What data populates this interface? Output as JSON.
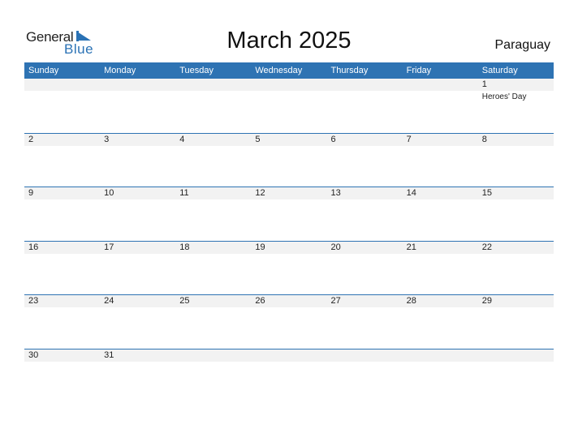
{
  "logo": {
    "general": "General",
    "blue": "Blue"
  },
  "title": "March 2025",
  "country": "Paraguay",
  "weekdays": [
    "Sunday",
    "Monday",
    "Tuesday",
    "Wednesday",
    "Thursday",
    "Friday",
    "Saturday"
  ],
  "weeks": [
    [
      {
        "d": ""
      },
      {
        "d": ""
      },
      {
        "d": ""
      },
      {
        "d": ""
      },
      {
        "d": ""
      },
      {
        "d": ""
      },
      {
        "d": "1",
        "holiday": "Heroes' Day"
      }
    ],
    [
      {
        "d": "2"
      },
      {
        "d": "3"
      },
      {
        "d": "4"
      },
      {
        "d": "5"
      },
      {
        "d": "6"
      },
      {
        "d": "7"
      },
      {
        "d": "8"
      }
    ],
    [
      {
        "d": "9"
      },
      {
        "d": "10"
      },
      {
        "d": "11"
      },
      {
        "d": "12"
      },
      {
        "d": "13"
      },
      {
        "d": "14"
      },
      {
        "d": "15"
      }
    ],
    [
      {
        "d": "16"
      },
      {
        "d": "17"
      },
      {
        "d": "18"
      },
      {
        "d": "19"
      },
      {
        "d": "20"
      },
      {
        "d": "21"
      },
      {
        "d": "22"
      }
    ],
    [
      {
        "d": "23"
      },
      {
        "d": "24"
      },
      {
        "d": "25"
      },
      {
        "d": "26"
      },
      {
        "d": "27"
      },
      {
        "d": "28"
      },
      {
        "d": "29"
      }
    ],
    [
      {
        "d": "30"
      },
      {
        "d": "31"
      },
      {
        "d": ""
      },
      {
        "d": ""
      },
      {
        "d": ""
      },
      {
        "d": ""
      },
      {
        "d": ""
      }
    ]
  ],
  "colors": {
    "accent": "#2e73b3",
    "strip": "#f2f2f2"
  }
}
